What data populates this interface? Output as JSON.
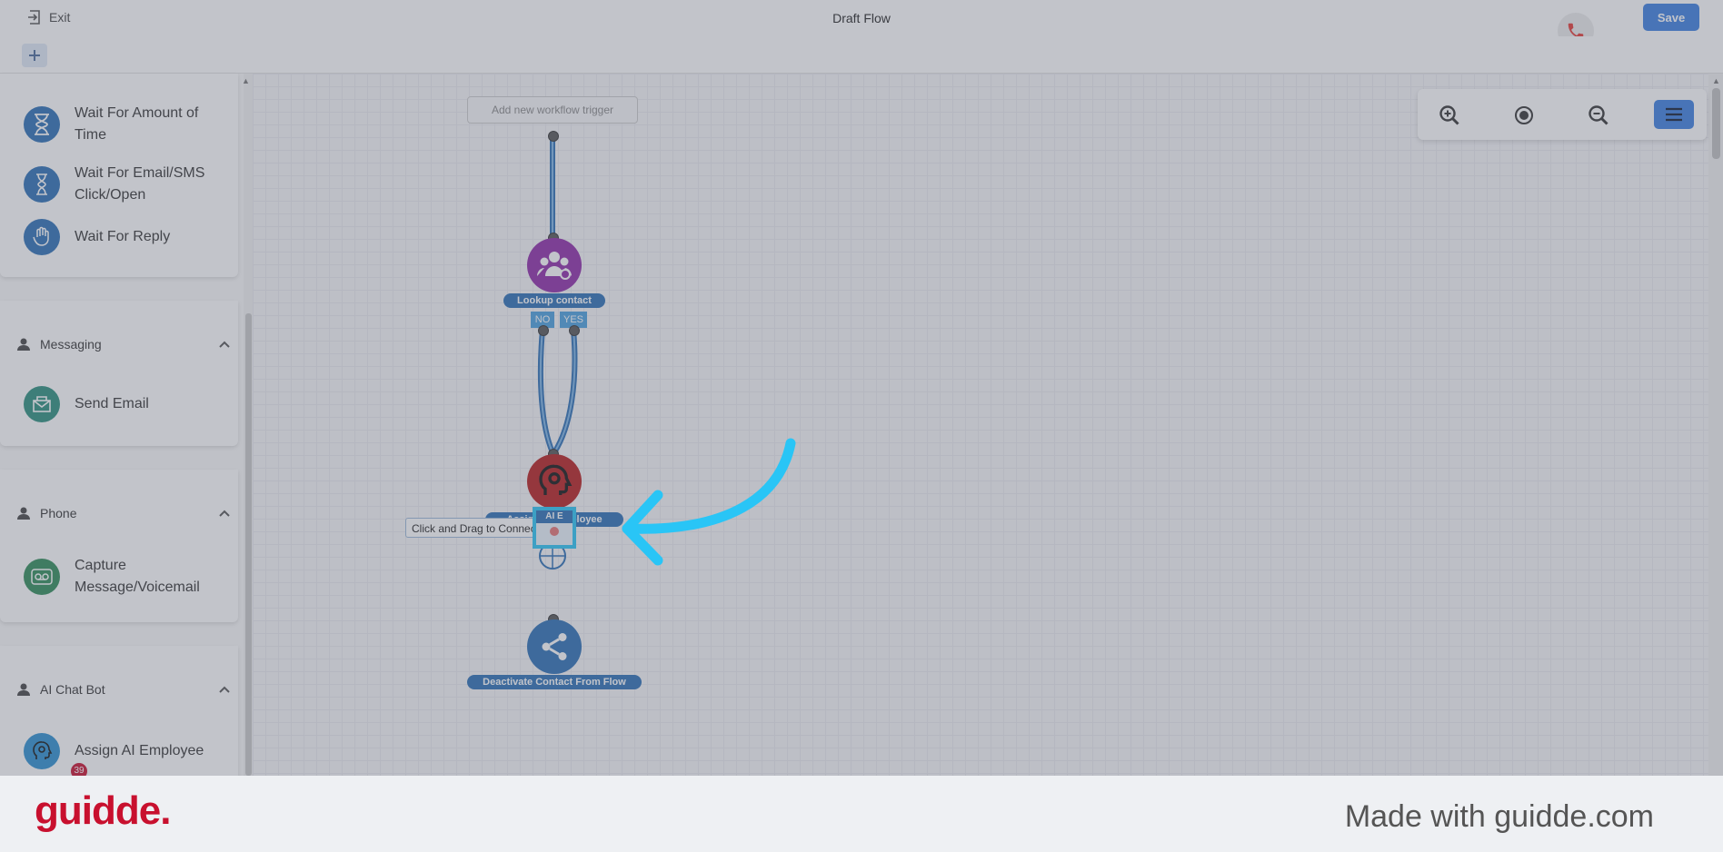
{
  "header": {
    "exit_label": "Exit",
    "title": "Draft Flow",
    "save_label": "Save"
  },
  "sidebar": {
    "wait_items": [
      {
        "label": "Wait For Amount of Time"
      },
      {
        "label": "Wait For Email/SMS Click/Open"
      },
      {
        "label": "Wait For Reply"
      }
    ],
    "sections": [
      {
        "title": "Messaging",
        "items": [
          {
            "label": "Send Email"
          }
        ]
      },
      {
        "title": "Phone",
        "items": [
          {
            "label": "Capture Message/Voicemail"
          }
        ]
      },
      {
        "title": "AI Chat Bot",
        "items": [
          {
            "label": "Assign AI Employee",
            "badge": "39"
          }
        ]
      }
    ]
  },
  "canvas": {
    "trigger_placeholder": "Add new workflow trigger",
    "nodes": [
      {
        "label": "Lookup contact",
        "color": "#8e2ba8"
      },
      {
        "label": "Assign AI Employee",
        "color": "#b71c1c"
      },
      {
        "label": "Deactivate Contact From Flow",
        "color": "#2a6fb5"
      }
    ],
    "branch_no": "NO",
    "branch_yes": "YES",
    "tooltip": "Click and Drag to Connect",
    "handle_label": "AI E"
  },
  "colors": {
    "accent": "#3a7fe0",
    "highlight": "#29c5f6",
    "brand": "#c8102e"
  },
  "footer": {
    "brand": "guidde.",
    "made_with": "Made with guidde.com"
  }
}
